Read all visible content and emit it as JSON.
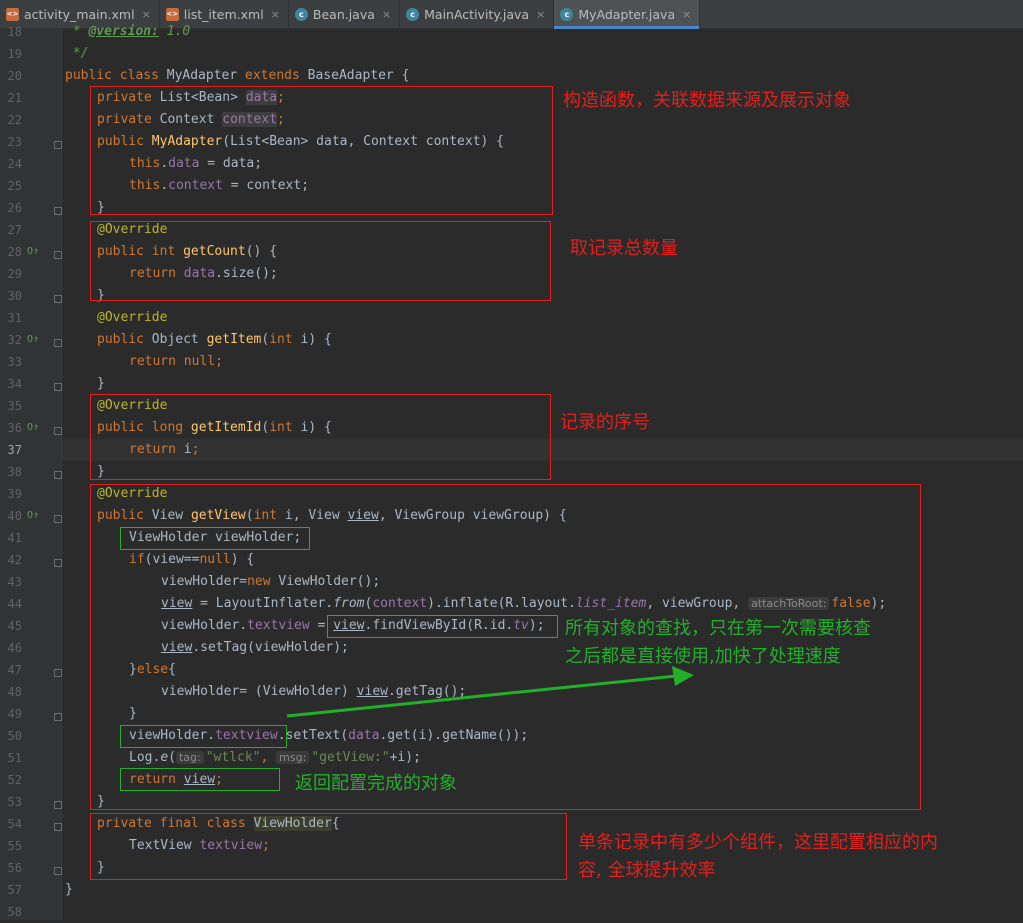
{
  "tabs": [
    {
      "label": "activity_main.xml",
      "icon": "xml-file-icon",
      "close": "×"
    },
    {
      "label": "list_item.xml",
      "icon": "xml-file-icon",
      "close": "×"
    },
    {
      "label": "Bean.java",
      "icon": "java-class-icon",
      "close": "×"
    },
    {
      "label": "MainActivity.java",
      "icon": "java-class-icon",
      "close": "×"
    },
    {
      "label": "MyAdapter.java",
      "icon": "java-class-icon",
      "close": "×",
      "active": true
    }
  ],
  "icon_glyphs": {
    "xml": "<>",
    "class": "c"
  },
  "gutter": {
    "line_numbers": [
      "18",
      "19",
      "20",
      "21",
      "22",
      "23",
      "24",
      "25",
      "26",
      "27",
      "28",
      "29",
      "30",
      "31",
      "32",
      "33",
      "34",
      "35",
      "36",
      "37",
      "38",
      "39",
      "40",
      "41",
      "42",
      "43",
      "44",
      "45",
      "46",
      "47",
      "48",
      "49",
      "50",
      "51",
      "52",
      "53",
      "54",
      "55",
      "56",
      "57",
      "58"
    ],
    "current_line": "37",
    "override_marker": "O↑"
  },
  "code": {
    "l18": [
      " * ",
      "@version:",
      " 1.0"
    ],
    "l19": [
      " */"
    ],
    "l20": [
      "public class ",
      "MyAdapter ",
      "extends ",
      "BaseAdapter {"
    ],
    "l21": [
      "private ",
      "List<Bean> ",
      "data",
      ";"
    ],
    "l22": [
      "private ",
      "Context ",
      "context",
      ";"
    ],
    "l23": [
      "public ",
      "MyAdapter",
      "(List<Bean> data, Context context) {"
    ],
    "l24": [
      "this",
      ".",
      "data",
      " = data;"
    ],
    "l25": [
      "this",
      ".",
      "context",
      " = context;"
    ],
    "l26": [
      "}"
    ],
    "l27": [
      "@Override"
    ],
    "l28": [
      "public int ",
      "getCount",
      "() {"
    ],
    "l29": [
      "return ",
      "data",
      ".size();"
    ],
    "l30": [
      "}"
    ],
    "l31": [
      "@Override"
    ],
    "l32": [
      "public ",
      "Object ",
      "getItem",
      "(",
      "int",
      " i) {"
    ],
    "l33": [
      "return ",
      "null",
      ";"
    ],
    "l34": [
      "}"
    ],
    "l35": [
      "@Override"
    ],
    "l36": [
      "public long ",
      "getItemId",
      "(",
      "int",
      " i) {"
    ],
    "l37": [
      "return ",
      "i",
      ";"
    ],
    "l38": [
      "}"
    ],
    "l39": [
      "@Override"
    ],
    "l40": [
      "public ",
      "View ",
      "getView",
      "(",
      "int",
      " i, View ",
      "view",
      ", ViewGroup viewGroup) {"
    ],
    "l41": [
      "ViewHolder viewHolder;"
    ],
    "l42": [
      "if",
      "(view==",
      "null",
      ") {"
    ],
    "l43": [
      "viewHolder=",
      "new ",
      "ViewHolder();"
    ],
    "l44": [
      "view",
      " = LayoutInflater.",
      "from",
      "(",
      "context",
      ").inflate(R.layout.",
      "list_item",
      ", viewGroup, ",
      "attachToRoot:",
      "false",
      ");"
    ],
    "l45": [
      "viewHolder.",
      "textview",
      " = ",
      "view",
      ".findViewById(R.id.",
      "tv",
      ");"
    ],
    "l46": [
      "view",
      ".setTag(viewHolder);"
    ],
    "l47": [
      "}",
      "else",
      "{"
    ],
    "l48": [
      "viewHolder= (ViewHolder) ",
      "view",
      ".getTag();"
    ],
    "l49": [
      "}"
    ],
    "l50": [
      "viewHolder.",
      "textview",
      ".setText(",
      "data",
      ".get(i).getName());"
    ],
    "l51": [
      "Log.",
      "e",
      "(",
      "tag:",
      "\"wtlck\"",
      ", ",
      "msg:",
      "\"getView:\"",
      "+i);"
    ],
    "l52": [
      "return ",
      "view",
      ";"
    ],
    "l53": [
      "}"
    ],
    "l54": [
      "private final class ",
      "ViewHolder",
      "{"
    ],
    "l55": [
      "TextView ",
      "textview",
      ";"
    ],
    "l56": [
      "}"
    ],
    "l57": [
      "}"
    ]
  },
  "annotations": {
    "constructor": "构造函数，关联数据来源及展示对象",
    "count": "取记录总数量",
    "item_id": "记录的序号",
    "find_line1": "所有对象的查找，只在第一次需要核查",
    "find_line2": "之后都是直接使用,加快了处理速度",
    "return_view": "返回配置完成的对象",
    "holder_line1": "单条记录中有多少个组件，这里配置相应的内",
    "holder_line2": "容, 全球提升效率"
  },
  "colors": {
    "red": "#e0201c",
    "green": "#22b02a",
    "accent": "#4a88c7",
    "keyword": "#cc7832",
    "field": "#9876aa",
    "method": "#ffc66d",
    "annotation": "#bbb529"
  }
}
